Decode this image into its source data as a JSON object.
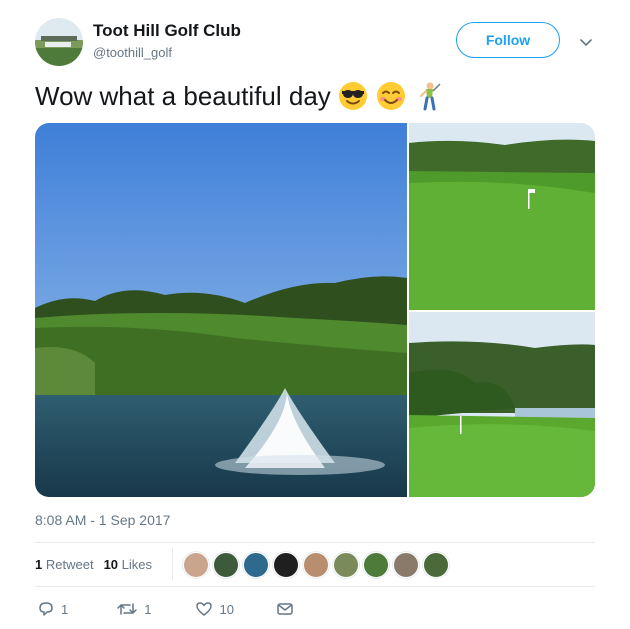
{
  "account": {
    "name": "Toot Hill Golf Club",
    "handle": "@toothill_golf"
  },
  "follow_label": "Follow",
  "tweet": {
    "text": "Wow what a beautiful day",
    "emojis": [
      "smiling-face-with-sunglasses",
      "smiling-face-with-smiling-eyes",
      "person-golfing"
    ]
  },
  "timestamp": "8:08 AM - 1 Sep 2017",
  "stats": {
    "retweets_count": "1",
    "retweets_label": "Retweet",
    "likes_count": "10",
    "likes_label": "Likes"
  },
  "actions": {
    "reply_count": "1",
    "retweet_count": "1",
    "like_count": "10"
  },
  "colors": {
    "accent": "#1da1f2",
    "secondary_text": "#657786",
    "divider": "#e6ecf0"
  }
}
